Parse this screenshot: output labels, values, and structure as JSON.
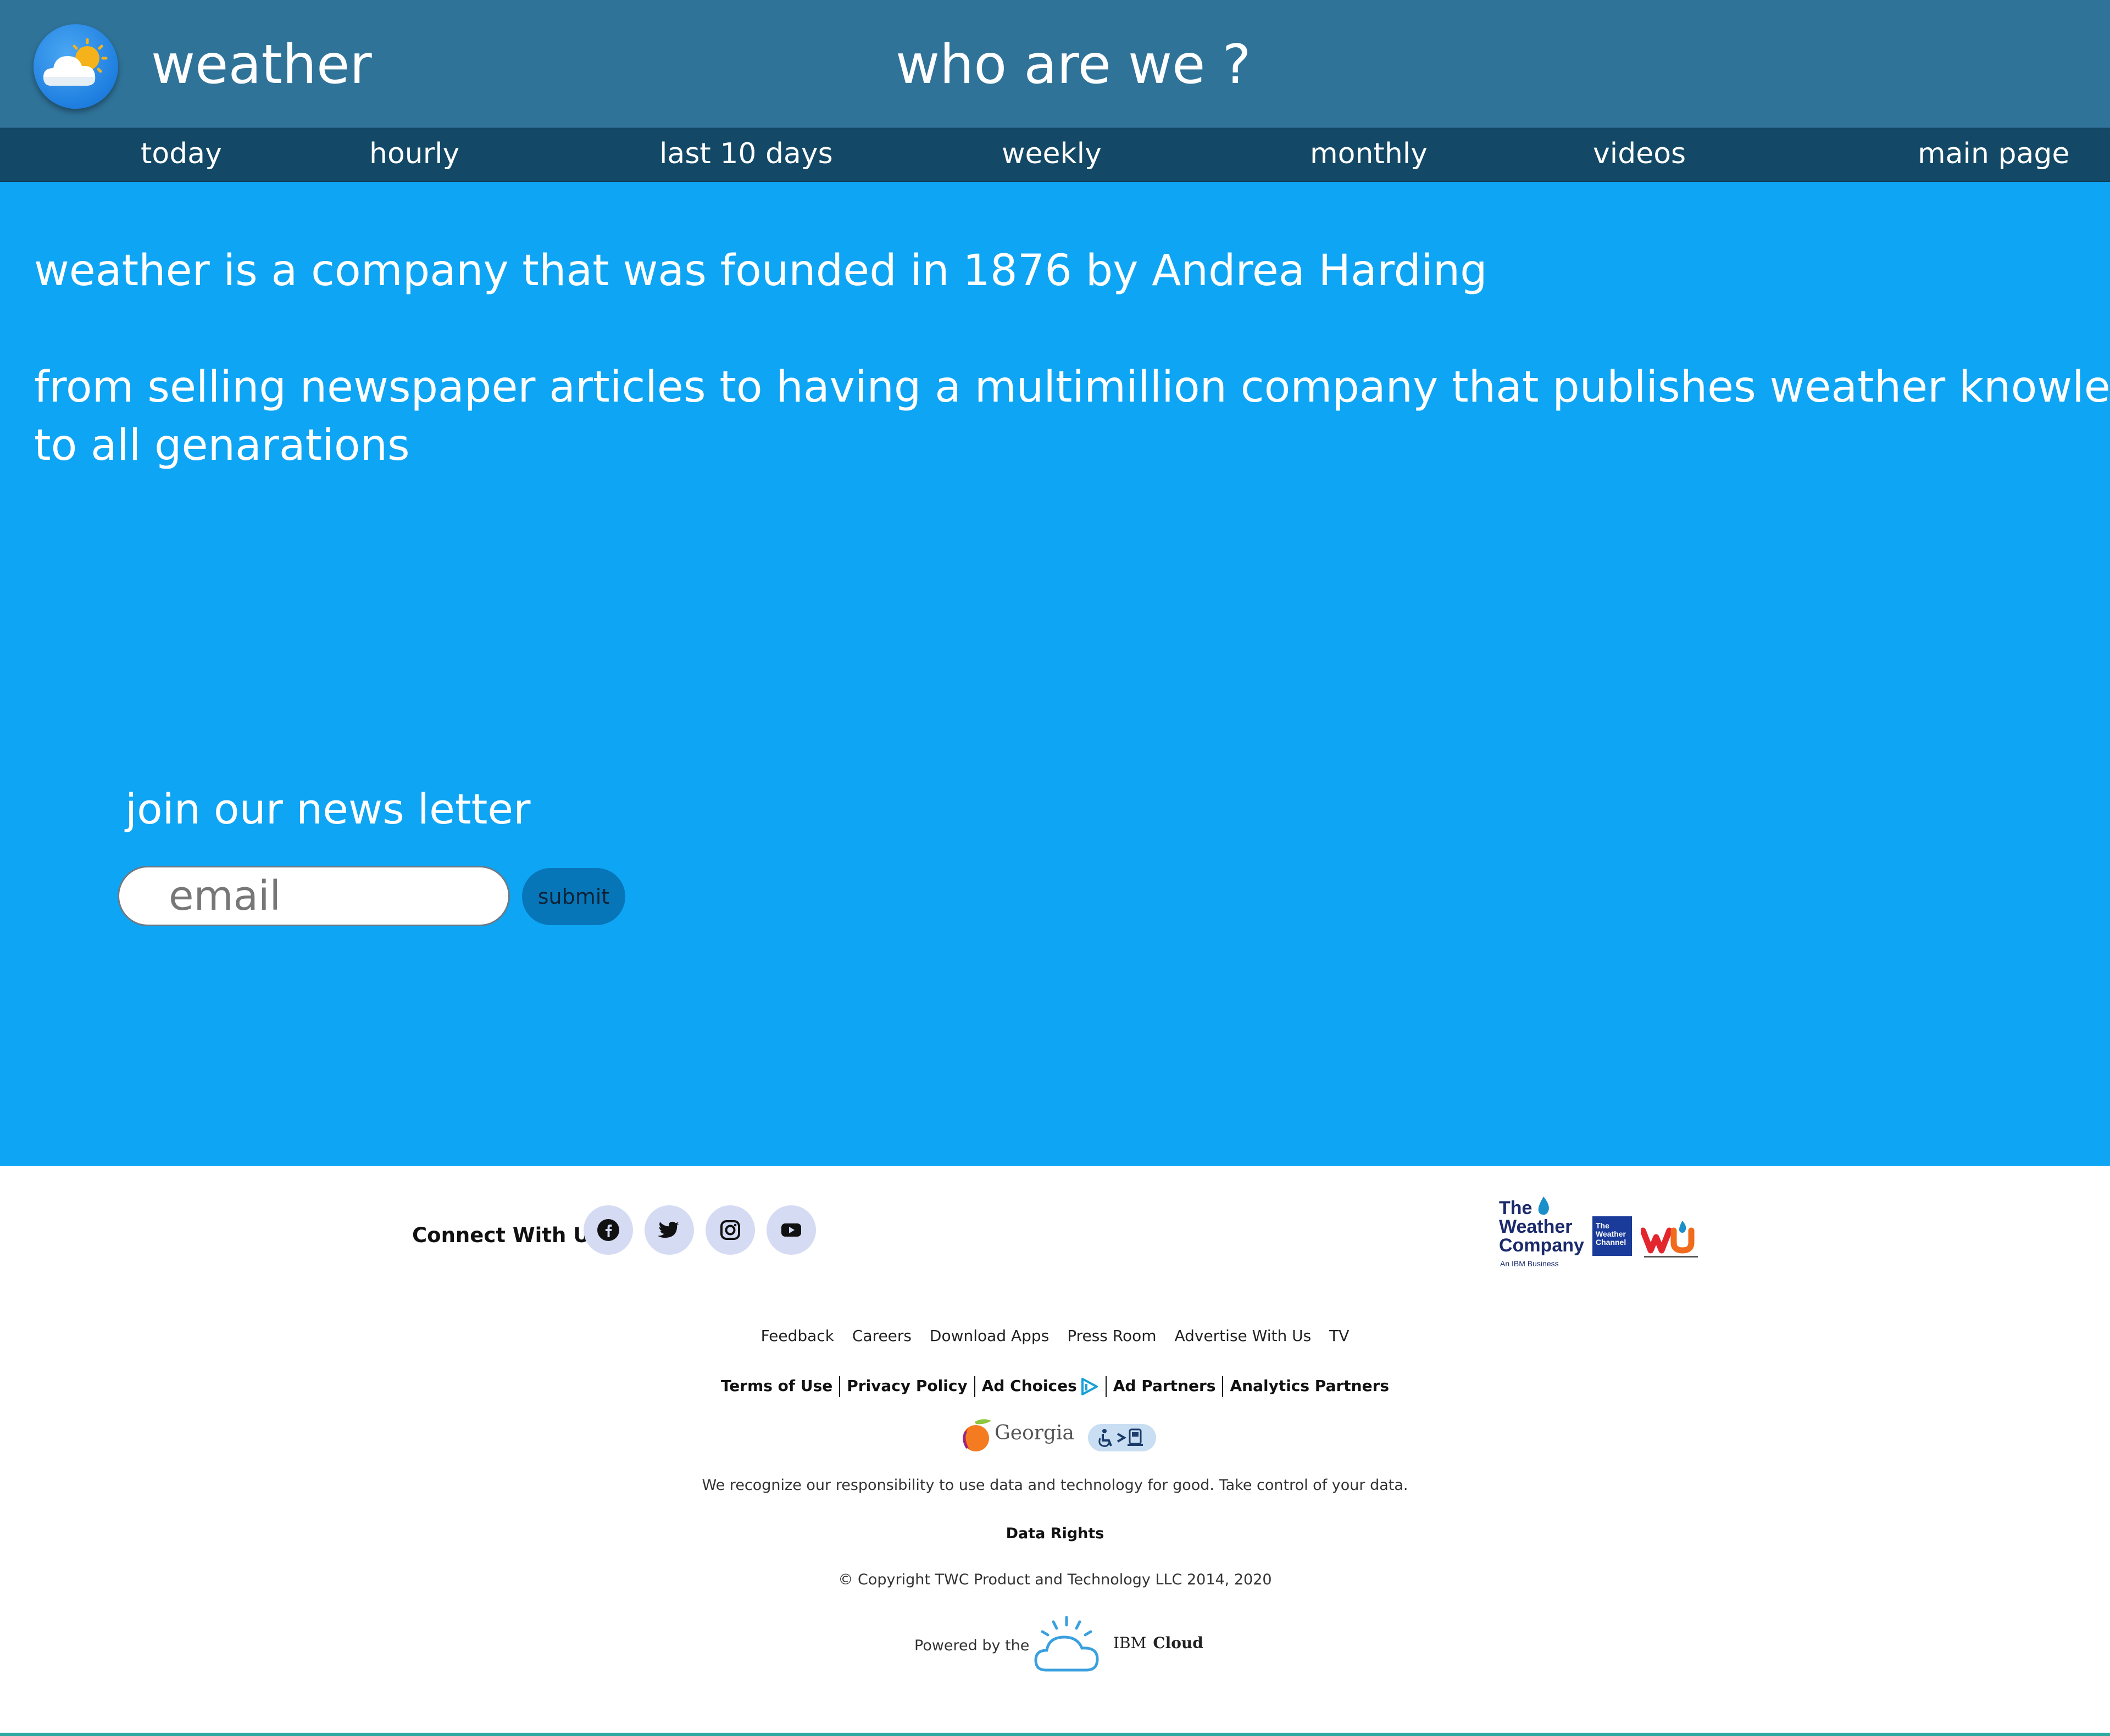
{
  "header": {
    "brand": "weather",
    "headline": "who are we ?",
    "logo_icon": "weather-app-logo-icon"
  },
  "nav": {
    "items": [
      {
        "label": "today"
      },
      {
        "label": "hourly"
      },
      {
        "label": "last 10 days"
      },
      {
        "label": "weekly"
      },
      {
        "label": "monthly"
      },
      {
        "label": "videos"
      },
      {
        "label": "main page"
      }
    ]
  },
  "main": {
    "paragraph1": "weather is a company that was founded in 1876 by Andrea Harding",
    "paragraph2_line1": "from selling newspaper articles to having a multimillion company that publishes weather knowledge",
    "paragraph2_line2": "to all genarations",
    "newsletter": {
      "title": "join our news letter",
      "email_placeholder": "email",
      "submit_label": "submit"
    }
  },
  "footer": {
    "connect_label": "Connect With Us",
    "social": [
      {
        "icon": "facebook-icon"
      },
      {
        "icon": "twitter-icon"
      },
      {
        "icon": "instagram-icon"
      },
      {
        "icon": "youtube-icon"
      }
    ],
    "brands": {
      "twc_name": "The\nWeather\nCompany",
      "twc_sub": "An IBM Business",
      "channel_name": "The\nWeather\nChannel"
    },
    "links_row1": [
      "Feedback",
      "Careers",
      "Download Apps",
      "Press Room",
      "Advertise With Us",
      "TV"
    ],
    "links_row2": [
      "Terms of Use",
      "Privacy Policy",
      "Ad Choices",
      "Ad Partners",
      "Analytics Partners"
    ],
    "georgia_label": "Georgia",
    "responsibility": "We recognize our responsibility to use data and technology for good. Take control of your data.",
    "data_rights": "Data Rights",
    "copyright": "© Copyright TWC Product and Technology LLC 2014, 2020",
    "powered_by": "Powered by the",
    "ibm_text": "IBM",
    "cloud_text": "Cloud"
  },
  "colors": {
    "header_bg": "#2f7399",
    "nav_bg": "#134966",
    "main_bg": "#0ea5f4",
    "submit_bg": "#0776b8",
    "social_bg": "#d5dbf3"
  }
}
